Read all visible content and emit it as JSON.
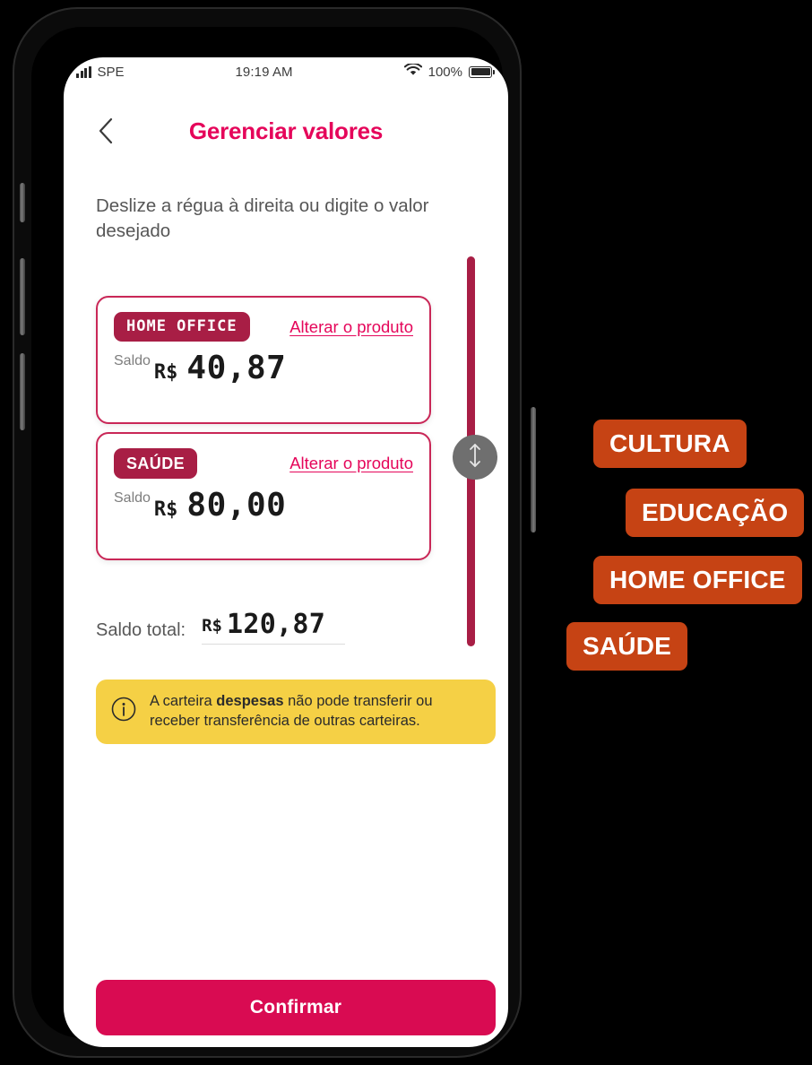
{
  "status_bar": {
    "carrier": "SPE",
    "time": "19:19 AM",
    "battery_percent": "100%",
    "signal_icon": "signal-bars-icon",
    "wifi_icon": "wifi-icon",
    "battery_icon": "battery-icon"
  },
  "header": {
    "back_icon": "chevron-left-icon",
    "title": "Gerenciar valores",
    "title_color": "#E5065A"
  },
  "subtitle": "Deslize a régua à direita ou digite o valor desejado",
  "slider": {
    "icon": "up-down-arrow-icon",
    "track_color": "#A81E45",
    "handle_color": "#6F6F6F"
  },
  "cards": [
    {
      "badge": "HOME OFFICE",
      "badge_color": "#A81E45",
      "change_link": "Alterar o produto",
      "balance_label": "Saldo",
      "currency": "R$",
      "value": "40,87"
    },
    {
      "badge": "SAÚDE",
      "badge_color": "#A81E45",
      "change_link": "Alterar o produto",
      "balance_label": "Saldo",
      "currency": "R$",
      "value": "80,00"
    }
  ],
  "total": {
    "label": "Saldo total:",
    "currency": "R$",
    "value": "120,87"
  },
  "info_banner": {
    "icon": "info-circle-icon",
    "background": "#F5D045",
    "text_before": "A carteira ",
    "text_bold": "despesas",
    "text_after": " não pode transferir ou receber transferência de outras carteiras."
  },
  "confirm_button": {
    "label": "Confirmar",
    "color": "#D90B52"
  },
  "annotation_tags": {
    "color": "#C64314",
    "items": [
      {
        "label": "CULTURA"
      },
      {
        "label": "EDUCAÇÃO"
      },
      {
        "label": "HOME OFFICE"
      },
      {
        "label": "SAÚDE"
      }
    ]
  }
}
